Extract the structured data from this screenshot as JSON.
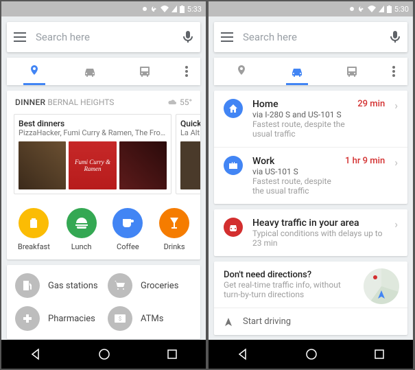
{
  "left": {
    "status_time": "5:33",
    "search_placeholder": "Search here",
    "dinner": {
      "category": "DINNER",
      "area": "BERNAL HEIGHTS",
      "temp": "55°",
      "best_title": "Best dinners",
      "best_sub": "PizzaHacker, Fumi Curry & Ramen, The Front...",
      "img2_label": "Fumi Curry & Ramen",
      "peek_title": "Quick",
      "peek_sub": "La Alt"
    },
    "cats": {
      "breakfast": "Breakfast",
      "lunch": "Lunch",
      "coffee": "Coffee",
      "drinks": "Drinks"
    },
    "services": {
      "gas": "Gas stations",
      "groceries": "Groceries",
      "pharmacies": "Pharmacies",
      "atms": "ATMs"
    }
  },
  "right": {
    "status_time": "5:30",
    "search_placeholder": "Search here",
    "home": {
      "title": "Home",
      "via": "via I-280 S and US-101 S",
      "sub": "Fastest route, despite the usual traffic",
      "time": "29 min"
    },
    "work": {
      "title": "Work",
      "via": "via US-101 S",
      "sub": "Fastest route, despite the usual traffic",
      "time": "1 hr 9 min"
    },
    "traffic": {
      "title": "Heavy traffic in your area",
      "sub": "Typical conditions with delays up to 23 min"
    },
    "nodir": {
      "title": "Don't need directions?",
      "sub": "Get real-time traffic info, without turn-by-turn directions"
    },
    "start": "Start driving"
  }
}
